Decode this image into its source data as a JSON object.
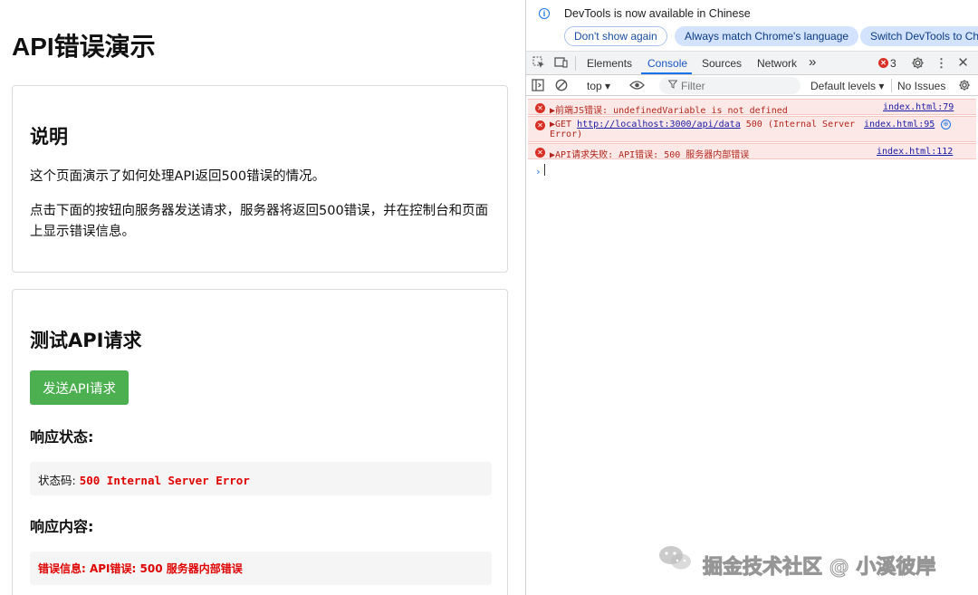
{
  "page": {
    "title": "API错误演示",
    "card1": {
      "heading": "说明",
      "para1": "这个页面演示了如何处理API返回500错误的情况。",
      "para2": "点击下面的按钮向服务器发送请求，服务器将返回500错误，并在控制台和页面上显示错误信息。"
    },
    "card2": {
      "heading": "测试API请求",
      "button": "发送API请求",
      "status_heading": "响应状态:",
      "status_label": "状态码: ",
      "status_value": "500 Internal Server Error",
      "content_heading": "响应内容:",
      "content_value": "错误信息: API错误: 500 服务器内部错误"
    }
  },
  "devtools": {
    "notice": {
      "text": "DevTools is now available in Chinese",
      "btn_dont_show": "Don't show again",
      "btn_match": "Always match Chrome's language",
      "btn_switch": "Switch DevTools to Chi"
    },
    "tabs": [
      "Elements",
      "Console",
      "Sources",
      "Network"
    ],
    "more_tabs": "»",
    "error_count": "3",
    "toolbar": {
      "context": "top ▾",
      "filter_placeholder": "Filter",
      "levels": "Default levels ▾",
      "issues": "No Issues"
    },
    "messages": [
      {
        "text": "▶前端JS错误: undefinedVariable is not defined",
        "source": "index.html:79"
      },
      {
        "prefix": "▶GET ",
        "url": "http://localhost:3000/api/data",
        "suffix": " 500 (Internal Server Error)",
        "source": "index.html:95"
      },
      {
        "text": "▶API请求失败: API错误: 500 服务器内部错误",
        "source": "index.html:112"
      }
    ],
    "prompt": "›"
  },
  "watermark": {
    "text": "掘金技术社区 @ 小溪彼岸"
  },
  "colors": {
    "button_green": "#4caf50",
    "error_red": "#e00000",
    "devtools_blue": "#1a73e8"
  }
}
